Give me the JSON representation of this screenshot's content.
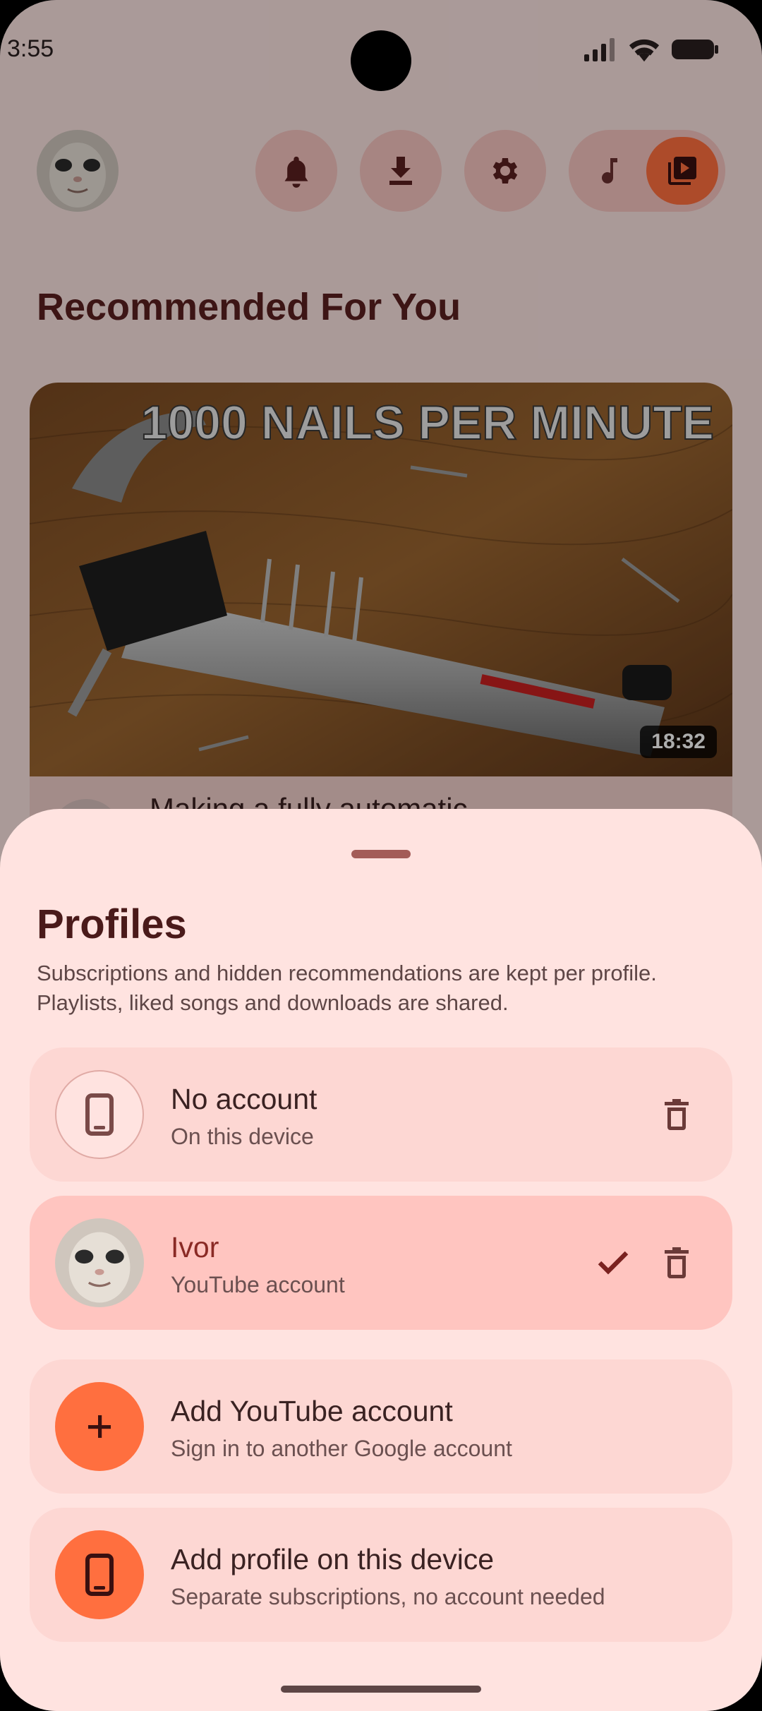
{
  "status_bar": {
    "time": "3:55"
  },
  "top_bar": {
    "icons": [
      "avatar",
      "bell-icon",
      "download-icon",
      "gear-icon",
      "music-note-icon",
      "video-library-icon"
    ]
  },
  "home": {
    "section_title": "Recommended For You",
    "video": {
      "thumbnail_text": "1000 NAILS PER MINUTE",
      "duration": "18:32",
      "title_partial": "Making a fully automatic"
    }
  },
  "sheet": {
    "title": "Profiles",
    "description": "Subscriptions and hidden recommendations are kept per profile. Playlists, liked songs and downloads are shared.",
    "profiles": [
      {
        "name": "No account",
        "subtitle": "On this device",
        "icon": "phone-icon",
        "selected": false,
        "deletable": true
      },
      {
        "name": "Ivor",
        "subtitle": "YouTube account",
        "icon": "avatar",
        "selected": true,
        "deletable": true
      }
    ],
    "actions": [
      {
        "label": "Add YouTube account",
        "subtitle": "Sign in to another Google account",
        "icon": "plus-icon"
      },
      {
        "label": "Add profile on this device",
        "subtitle": "Separate subscriptions, no account needed",
        "icon": "phone-icon"
      }
    ]
  },
  "colors": {
    "accent": "#ff6f3f",
    "sheet_bg": "#ffe3e0",
    "card_bg": "#fdd7d3",
    "card_selected_bg": "#ffc5c0",
    "title_text": "#4a1a1a"
  }
}
